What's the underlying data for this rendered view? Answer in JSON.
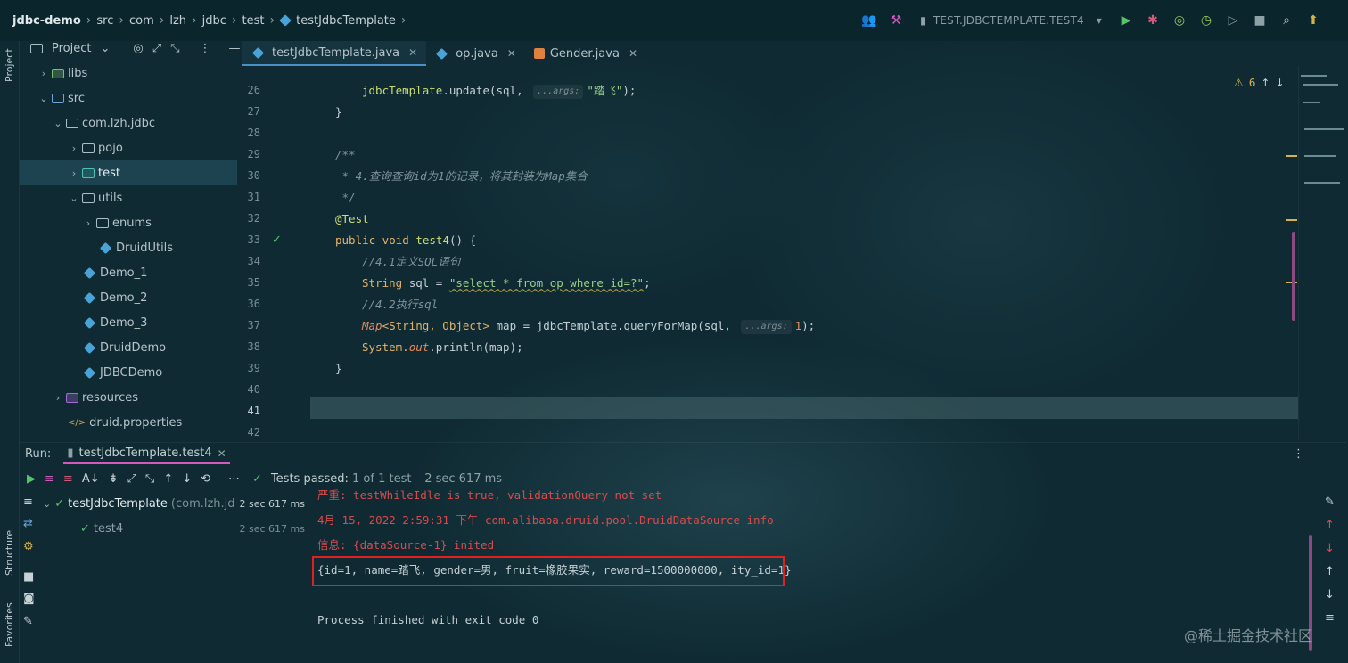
{
  "breadcrumbs": {
    "items": [
      "jdbc-demo",
      "src",
      "com",
      "lzh",
      "jdbc",
      "test",
      "testJdbcTemplate"
    ]
  },
  "toolbar": {
    "run_config": "TEST.JDBCTEMPLATE.TEST4"
  },
  "side_tools": {
    "project": "Project",
    "structure": "Structure",
    "favorites": "Favorites"
  },
  "project_panel": {
    "title": "Project",
    "tree": [
      {
        "label": "libs",
        "arrow": "›"
      },
      {
        "label": "src",
        "arrow": "⌄"
      },
      {
        "label": "com.lzh.jdbc",
        "arrow": "⌄"
      },
      {
        "label": "pojo",
        "arrow": "›"
      },
      {
        "label": "test",
        "arrow": "›",
        "selected": true
      },
      {
        "label": "utils",
        "arrow": "⌄"
      },
      {
        "label": "enums",
        "arrow": "›"
      },
      {
        "label": "DruidUtils"
      },
      {
        "label": "Demo_1"
      },
      {
        "label": "Demo_2"
      },
      {
        "label": "Demo_3"
      },
      {
        "label": "DruidDemo"
      },
      {
        "label": "JDBCDemo"
      },
      {
        "label": "resources",
        "arrow": "›"
      },
      {
        "label": "druid.properties"
      }
    ]
  },
  "editor": {
    "tabs": [
      {
        "label": "testJdbcTemplate.java",
        "active": true
      },
      {
        "label": "op.java"
      },
      {
        "label": "Gender.java"
      }
    ],
    "line_numbers": [
      "26",
      "27",
      "28",
      "29",
      "30",
      "31",
      "32",
      "33",
      "34",
      "35",
      "36",
      "37",
      "38",
      "39",
      "40",
      "41",
      "42"
    ],
    "code": {
      "l26_a": "jdbcTemplate",
      "l26_b": ".update(sql, ",
      "l26_hint": "...args:",
      "l26_c": "\"踏飞\"",
      "l26_d": ");",
      "l27": "}",
      "l29": "/**",
      "l30": " * 4.查询查询id为1的记录，将其封装为Map集合",
      "l31": " */",
      "l32": "@Test",
      "l33_kw": "public void ",
      "l33_fn": "test4",
      "l33_rest": "() {",
      "l34": "//4.1定义SQL语句",
      "l35_kw": "String ",
      "l35_var": "sql = ",
      "l35_str": "\"select * from op where id=?\"",
      "l35_end": ";",
      "l36": "//4.2执行sql",
      "l37_t": "Map",
      "l37_g": "<String, Object> ",
      "l37_v": "map = jdbcTemplate.queryForMap(sql, ",
      "l37_hint": "...args:",
      "l37_n": "1",
      "l37_e": ");",
      "l38_a": "System.",
      "l38_b": "out",
      "l38_c": ".println(map);",
      "l39": "}"
    },
    "warnings_count": "6"
  },
  "run_panel": {
    "label": "Run:",
    "tab": "testJdbcTemplate.test4",
    "status_prefix": "Tests passed:",
    "status_rest": "1 of 1 test – 2 sec 617 ms",
    "tests": [
      {
        "name": "testJdbcTemplate",
        "pkg": "(com.lzh.jdbc",
        "time": "2 sec 617 ms"
      },
      {
        "name": "test4",
        "time": "2 sec 617 ms"
      }
    ],
    "console": [
      "严重: testWhileIdle is true, validationQuery not set",
      "4月 15, 2022 2:59:31 下午 com.alibaba.druid.pool.DruidDataSource info",
      "信息: {dataSource-1} inited",
      "{id=1, name=踏飞, gender=男, fruit=橡胶果实, reward=1500000000, ity_id=1}",
      "",
      "Process finished with exit code 0"
    ]
  },
  "watermark": "@稀土掘金技术社区",
  "colors": {
    "background": "#0f2a33",
    "highlight_box": "#e32020",
    "error_text": "#d94b4b",
    "keyword": "#e3b26a",
    "string": "#9ad08a"
  }
}
